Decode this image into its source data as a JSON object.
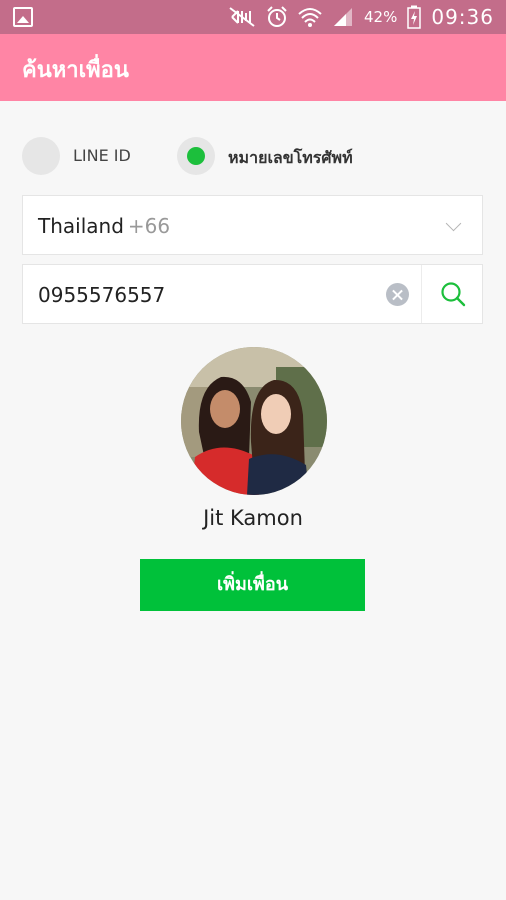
{
  "status_bar": {
    "icons": [
      "gallery-icon",
      "mute-icon",
      "alarm-icon",
      "wifi-icon",
      "signal-icon",
      "battery-charging-icon"
    ],
    "battery": "42%",
    "time": "09:36",
    "color": "#c36d8a"
  },
  "header": {
    "title": "ค้นหาเพื่อน",
    "color": "#ff85a5"
  },
  "search_type": {
    "options": [
      {
        "label": "LINE ID",
        "selected": false
      },
      {
        "label": "หมายเลขโทรศัพท์",
        "selected": true
      }
    ],
    "accent": "#1cbf3c"
  },
  "country": {
    "name": "Thailand",
    "code": "+66"
  },
  "phone_input": {
    "value": "0955576557"
  },
  "result": {
    "name": "Jit Kamon",
    "add_button_label": "เพิ่มเพื่อน",
    "button_color": "#00c13a"
  }
}
